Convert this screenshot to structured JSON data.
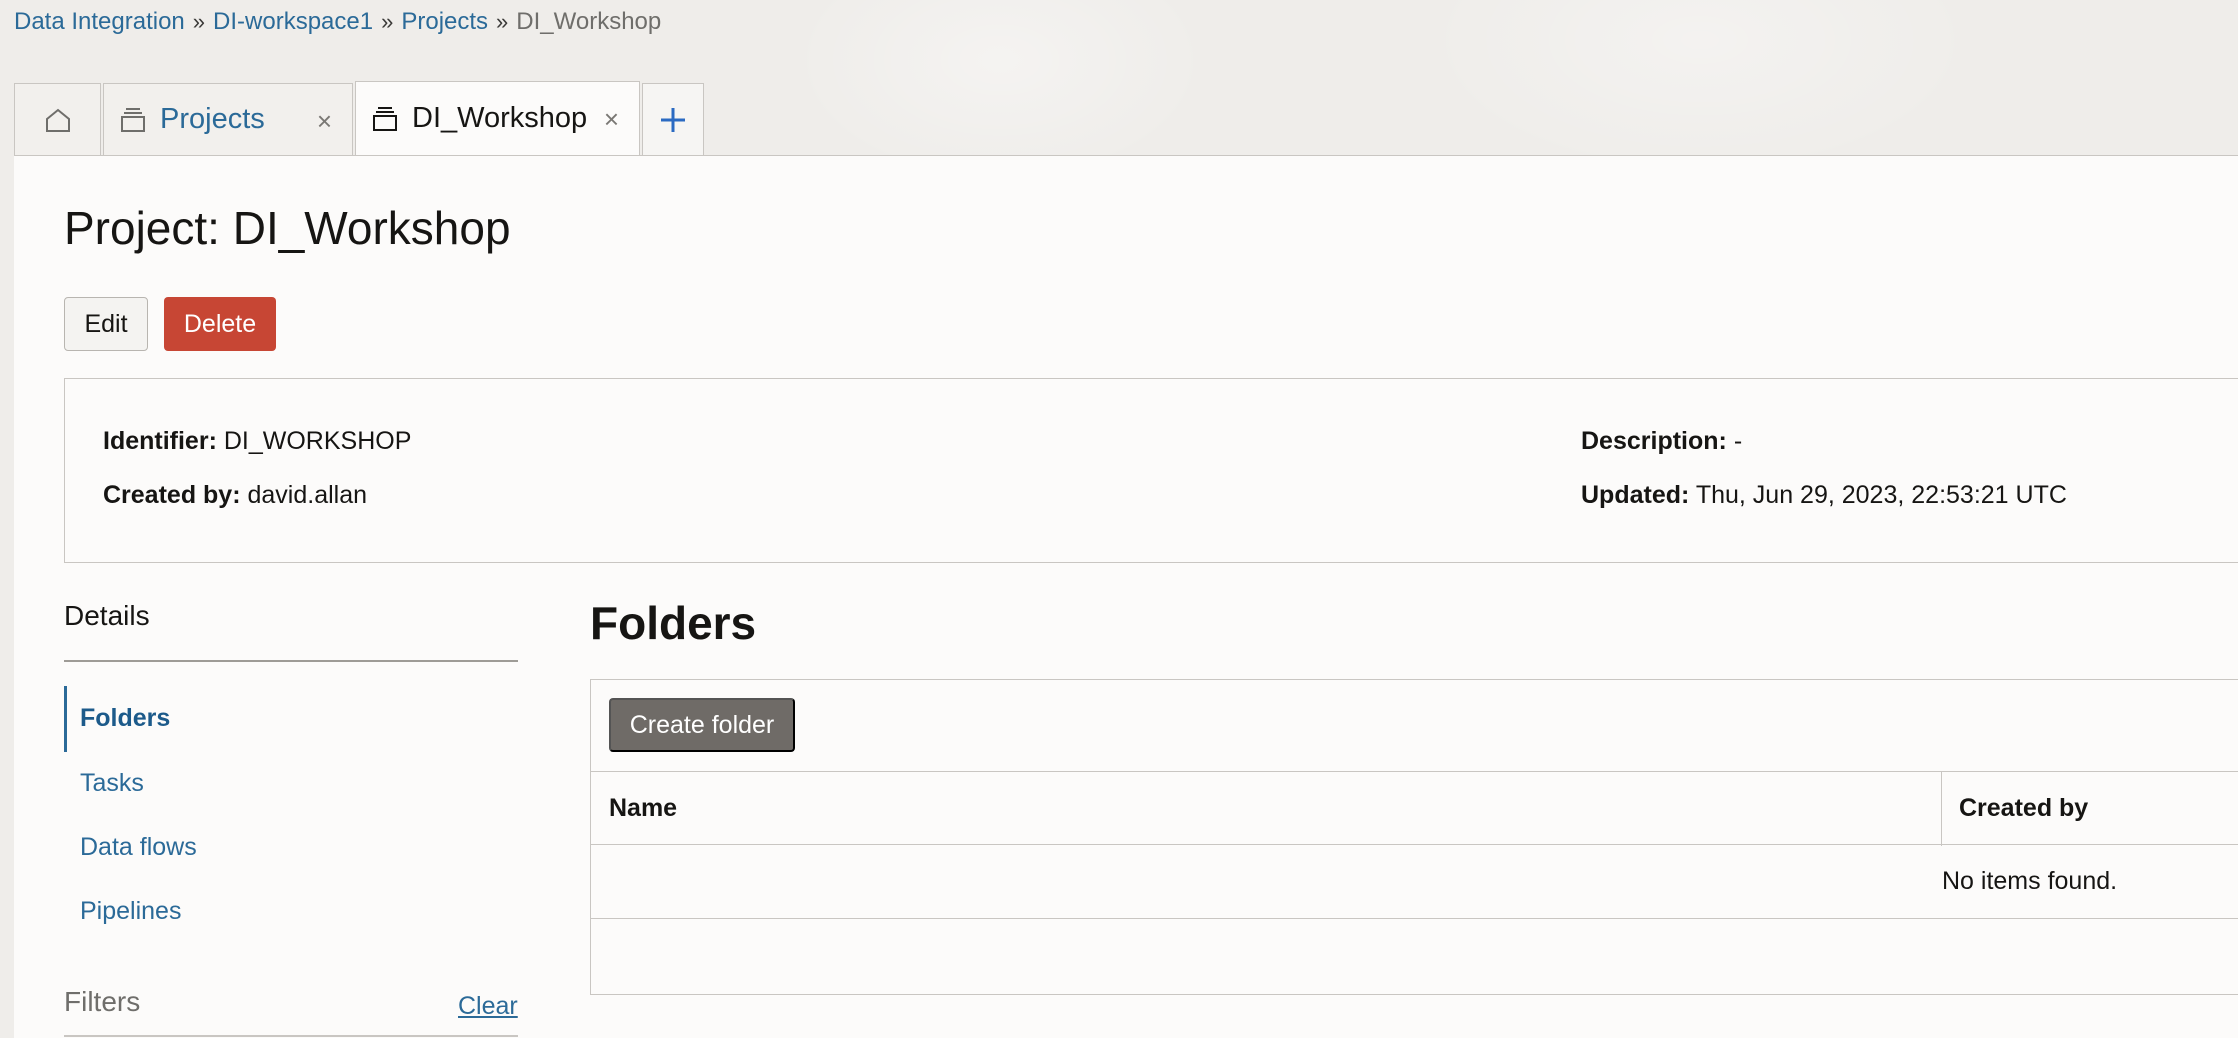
{
  "breadcrumb": {
    "items": [
      "Data Integration",
      "DI-workspace1",
      "Projects"
    ],
    "current": "DI_Workshop",
    "separator": "»"
  },
  "tabs": {
    "home_icon": "home-icon",
    "projects_label": "Projects",
    "active_label": "DI_Workshop",
    "close_glyph": "×",
    "add_glyph": "+"
  },
  "page": {
    "title": "Project: DI_Workshop",
    "edit_label": "Edit",
    "delete_label": "Delete"
  },
  "info": {
    "identifier_label": "Identifier:",
    "identifier_value": "DI_WORKSHOP",
    "created_by_label": "Created by:",
    "created_by_value": "david.allan",
    "description_label": "Description:",
    "description_value": "-",
    "updated_label": "Updated:",
    "updated_value": "Thu, Jun 29, 2023, 22:53:21 UTC"
  },
  "sidebar": {
    "heading": "Details",
    "items": [
      {
        "label": "Folders",
        "active": true
      },
      {
        "label": "Tasks",
        "active": false
      },
      {
        "label": "Data flows",
        "active": false
      },
      {
        "label": "Pipelines",
        "active": false
      }
    ],
    "filters_heading": "Filters",
    "clear_label": "Clear"
  },
  "folders": {
    "title": "Folders",
    "create_label": "Create folder",
    "columns": [
      "Name",
      "Created by"
    ],
    "empty_message": "No items found."
  },
  "colors": {
    "link": "#2b6a98",
    "delete": "#c74634",
    "create_button": "#6f6b67"
  }
}
